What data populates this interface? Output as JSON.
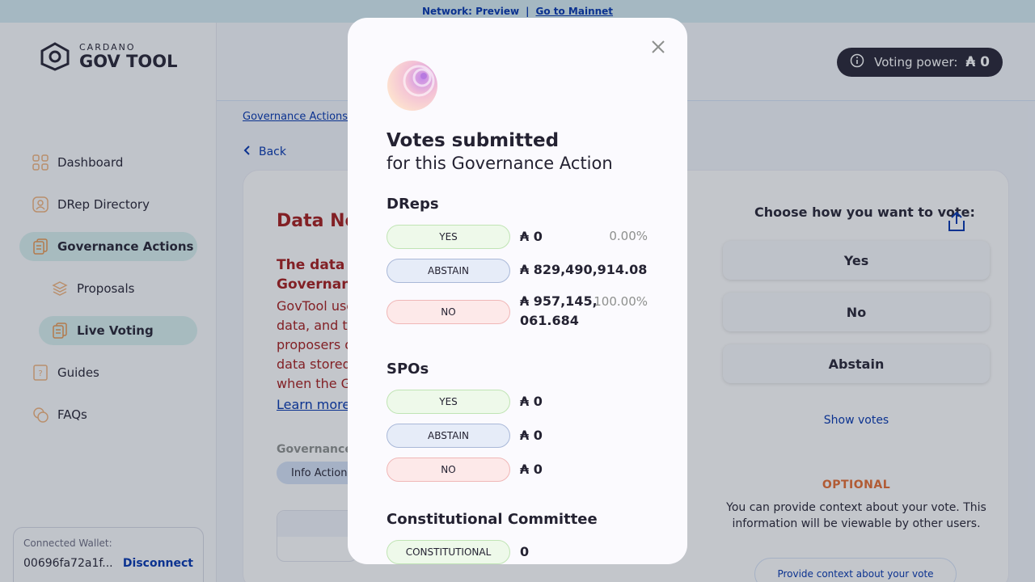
{
  "banner": {
    "network_label": "Network: Preview",
    "separator": "|",
    "mainnet_link": "Go to Mainnet"
  },
  "logo": {
    "small": "CARDANO",
    "big": "GOV TOOL"
  },
  "sidebar": {
    "items": [
      {
        "label": "Dashboard",
        "icon": "dashboard-icon"
      },
      {
        "label": "DRep Directory",
        "icon": "drep-directory-icon"
      },
      {
        "label": "Governance Actions",
        "icon": "governance-actions-icon"
      },
      {
        "label": "Proposals",
        "icon": "proposals-icon"
      },
      {
        "label": "Live Voting",
        "icon": "live-voting-icon"
      },
      {
        "label": "Guides",
        "icon": "guides-icon"
      },
      {
        "label": "FAQs",
        "icon": "faqs-icon"
      }
    ],
    "wallet": {
      "label": "Connected Wallet:",
      "address": "00696fa72a1f...",
      "disconnect": "Disconnect"
    }
  },
  "header": {
    "voting_power_label": "Voting power:",
    "voting_power_value": "₳ 0"
  },
  "breadcrumb": {
    "item": "Governance Actions"
  },
  "back_label": "Back",
  "card": {
    "title": "Data No",
    "subtitle_line1": "The data",
    "subtitle_line2": "Governan",
    "body_lines": [
      "GovTool use",
      "data, and th",
      "proposers o",
      "data stored",
      "when the G"
    ],
    "learn_more": "Learn more",
    "gov_label": "Governance",
    "type_pill": "Info Action"
  },
  "vote_panel": {
    "choose_title": "Choose how you want to vote:",
    "buttons": [
      "Yes",
      "No",
      "Abstain"
    ],
    "show_votes": "Show votes",
    "optional": "OPTIONAL",
    "context_text": "You can provide context about your vote. This information will be viewable by other users.",
    "context_button": "Provide context about your vote"
  },
  "modal": {
    "title": "Votes submitted",
    "subtitle": "for this Governance Action",
    "sections": [
      {
        "name": "DReps",
        "rows": [
          {
            "badge": "YES",
            "amount": "₳ 0",
            "percent": "0.00%"
          },
          {
            "badge": "ABSTAIN",
            "amount": "₳ 829,490,914.08",
            "percent": ""
          },
          {
            "badge": "NO",
            "amount": "₳ 957,145,061.684",
            "percent": "100.00%"
          }
        ]
      },
      {
        "name": "SPOs",
        "rows": [
          {
            "badge": "YES",
            "amount": "₳ 0"
          },
          {
            "badge": "ABSTAIN",
            "amount": "₳ 0"
          },
          {
            "badge": "NO",
            "amount": "₳ 0"
          }
        ]
      },
      {
        "name": "Constitutional Committee",
        "rows": [
          {
            "badge": "CONSTITUTIONAL",
            "amount": "0"
          }
        ]
      }
    ]
  },
  "colors": {
    "brand_blue": "#0033ad",
    "danger_red": "#a51a1a",
    "optional_orange": "#e76b2f",
    "active_nav": "#d8f0ef"
  }
}
